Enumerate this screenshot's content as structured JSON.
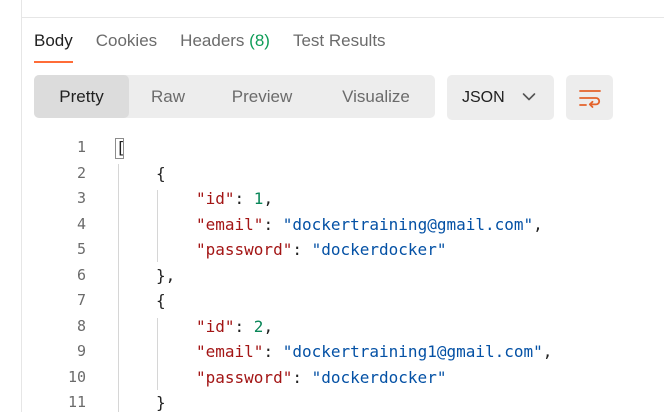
{
  "response_tabs": {
    "body": "Body",
    "cookies": "Cookies",
    "headers": "Headers",
    "headers_count": "(8)",
    "test_results": "Test Results"
  },
  "view_modes": [
    "Pretty",
    "Raw",
    "Preview",
    "Visualize"
  ],
  "format": {
    "selected": "JSON"
  },
  "icons": {
    "format_chevron": "chevron-down-icon",
    "wrap": "word-wrap-icon"
  },
  "colors": {
    "accent": "#ff6c37",
    "count": "#0f9d58",
    "key": "#a31515",
    "string": "#0451a5",
    "number": "#098658"
  },
  "code": {
    "line_numbers": [
      "1",
      "2",
      "3",
      "4",
      "5",
      "6",
      "7",
      "8",
      "9",
      "10",
      "11"
    ],
    "l1": "[",
    "l2": "{",
    "l3_key": "\"id\"",
    "l3_sep": ": ",
    "l3_val": "1",
    "l3_end": ",",
    "l4_key": "\"email\"",
    "l4_sep": ": ",
    "l4_val": "\"dockertraining@gmail.com\"",
    "l4_end": ",",
    "l5_key": "\"password\"",
    "l5_sep": ": ",
    "l5_val": "\"dockerdocker\"",
    "l6": "},",
    "l7": "{",
    "l8_key": "\"id\"",
    "l8_sep": ": ",
    "l8_val": "2",
    "l8_end": ",",
    "l9_key": "\"email\"",
    "l9_sep": ": ",
    "l9_val": "\"dockertraining1@gmail.com\"",
    "l9_end": ",",
    "l10_key": "\"password\"",
    "l10_sep": ": ",
    "l10_val": "\"dockerdocker\"",
    "l11": "}"
  }
}
